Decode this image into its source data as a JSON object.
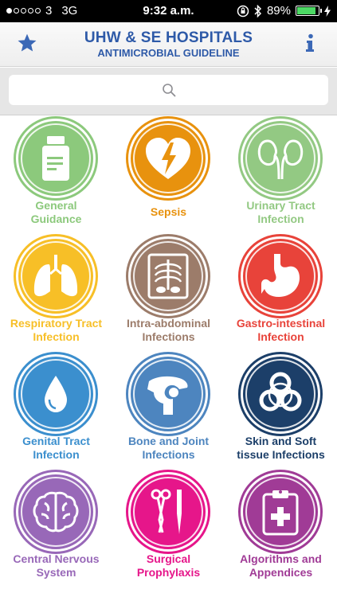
{
  "status_bar": {
    "carrier": "3",
    "network": "3G",
    "time": "9:32 a.m.",
    "battery": "89%",
    "battery_level": 0.89
  },
  "header": {
    "title": "UHW & SE HOSPITALS",
    "subtitle": "ANTIMICROBIAL GUIDELINE",
    "favorites_icon": "star-icon",
    "info_icon": "info-icon",
    "color": "#2e5aa8"
  },
  "search": {
    "placeholder": "",
    "value": ""
  },
  "categories": [
    {
      "label_1": "General",
      "label_2": "Guidance",
      "color": "#8cc97c",
      "icon": "medicine-bottle-icon"
    },
    {
      "label_1": "Sepsis",
      "label_2": "",
      "color": "#e8920e",
      "icon": "heart-defibrillator-icon"
    },
    {
      "label_1": "Urinary Tract",
      "label_2": "Infection",
      "color": "#93c983",
      "icon": "kidneys-icon"
    },
    {
      "label_1": "Respiratory Tract",
      "label_2": "Infection",
      "color": "#f7bf27",
      "icon": "lungs-icon"
    },
    {
      "label_1": "Intra-abdominal",
      "label_2": "Infections",
      "color": "#9c7c6a",
      "icon": "xray-icon"
    },
    {
      "label_1": "Gastro-intestinal",
      "label_2": "Infection",
      "color": "#e8433a",
      "icon": "stomach-icon"
    },
    {
      "label_1": "Genital Tract",
      "label_2": "Infection",
      "color": "#3b8fce",
      "icon": "droplet-icon"
    },
    {
      "label_1": "Bone and Joint",
      "label_2": "Infections",
      "color": "#4d85bf",
      "icon": "shoulder-joint-icon"
    },
    {
      "label_1": "Skin and Soft",
      "label_2": "tissue Infections",
      "color": "#1c3f69",
      "icon": "biohazard-icon"
    },
    {
      "label_1": "Central Nervous",
      "label_2": "System",
      "color": "#9868b8",
      "icon": "brain-icon"
    },
    {
      "label_1": "Surgical",
      "label_2": "Prophylaxis",
      "color": "#e6168a",
      "icon": "surgical-instruments-icon"
    },
    {
      "label_1": "Algorithms and",
      "label_2": "Appendices",
      "color": "#a03b96",
      "icon": "clipboard-icon"
    }
  ]
}
